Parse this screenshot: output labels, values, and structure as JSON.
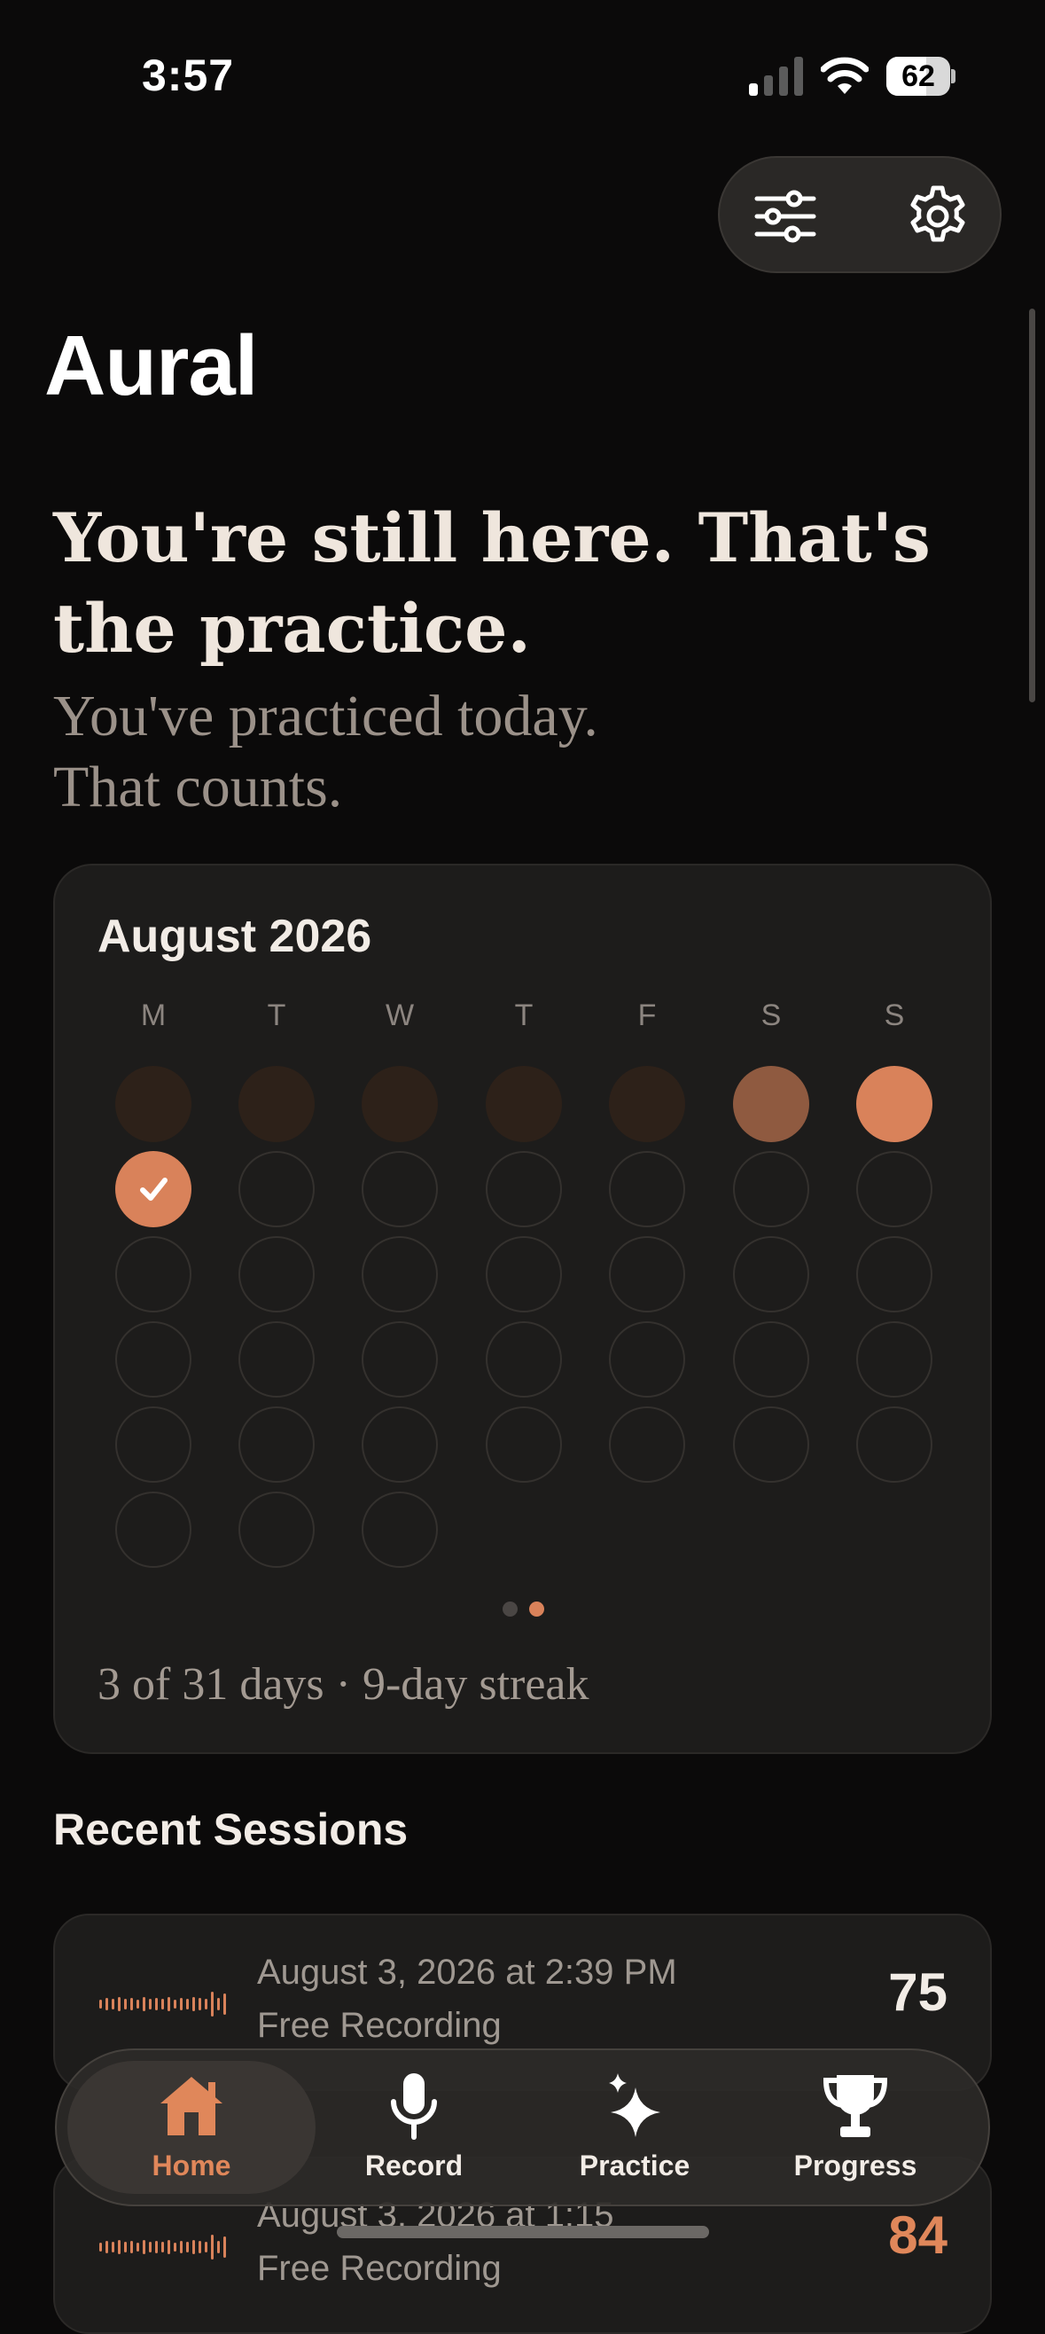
{
  "status_bar": {
    "time": "3:57",
    "battery": "62",
    "battery_level": 0.62
  },
  "toolbar": {
    "filters_icon": "sliders-icon",
    "settings_icon": "gear-icon"
  },
  "app_title": "Aural",
  "hero": {
    "headline": "You're still here. That's the practice.",
    "subline_1": "You've practiced today.",
    "subline_2": "That counts."
  },
  "calendar": {
    "month": "August 2026",
    "weekdays": [
      "M",
      "T",
      "W",
      "T",
      "F",
      "S",
      "S"
    ],
    "summary": "3 of 31 days · 9-day streak",
    "page_count": 2,
    "active_page": 1,
    "colors": {
      "accent": "#d9825a",
      "faded": "#2d2119",
      "mid": "#8f5a40",
      "empty_border": "#34312e"
    }
  },
  "recent": {
    "title": "Recent Sessions",
    "sessions": [
      {
        "date": "August 3, 2026 at 2:39 PM",
        "type": "Free Recording",
        "score": "75"
      },
      {
        "date": "August 3, 2026 at 1:15",
        "type": "Free Recording",
        "score": "84"
      }
    ]
  },
  "tabs": [
    {
      "label": "Home",
      "icon": "house-icon",
      "active": true
    },
    {
      "label": "Record",
      "icon": "microphone-icon",
      "active": false
    },
    {
      "label": "Practice",
      "icon": "sparkles-icon",
      "active": false
    },
    {
      "label": "Progress",
      "icon": "trophy-icon",
      "active": false
    }
  ]
}
